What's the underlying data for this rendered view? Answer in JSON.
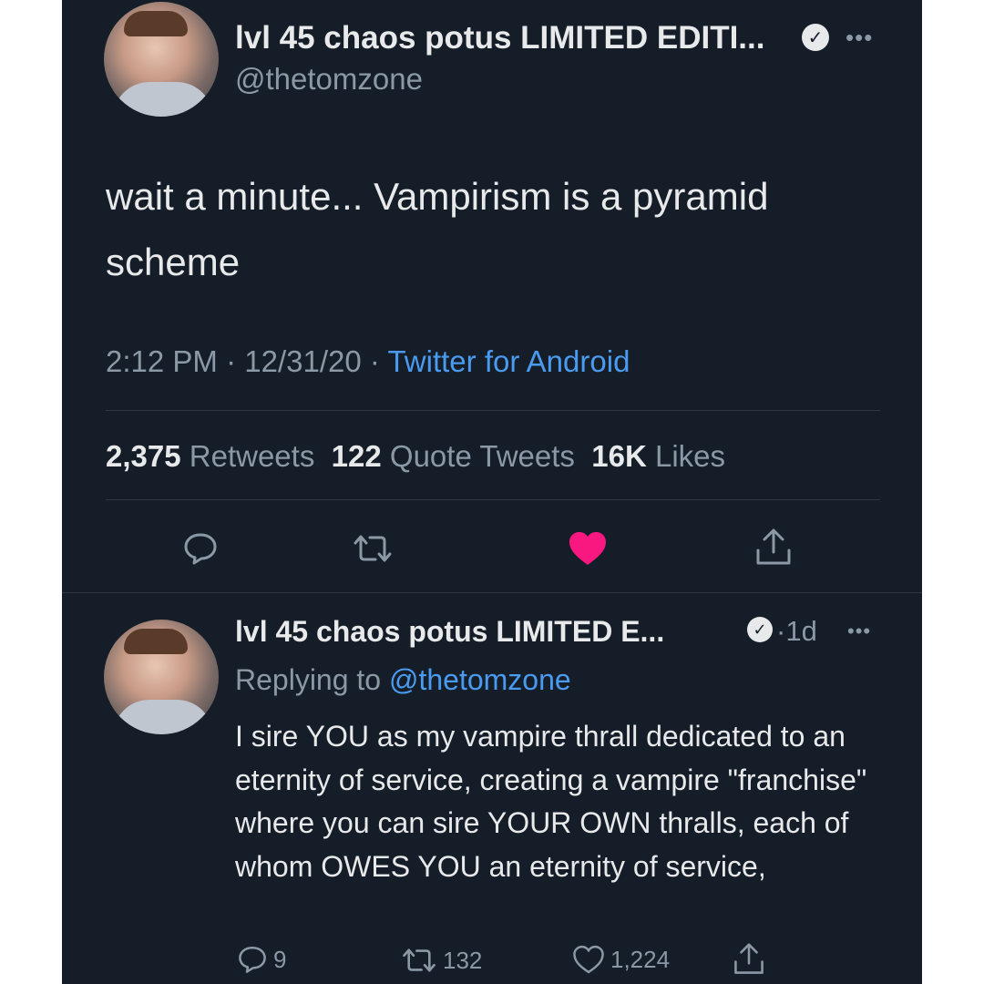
{
  "tweet": {
    "display_name": "lvl 45 chaos potus LIMITED EDITI...",
    "handle": "@thetomzone",
    "text": "wait a minute... Vampirism is a pyramid scheme",
    "time": "2:12 PM",
    "date": "12/31/20",
    "source": "Twitter for Android",
    "separator": "·",
    "stats": {
      "retweets_count": "2,375",
      "retweets_label": "Retweets",
      "quotes_count": "122",
      "quotes_label": "Quote Tweets",
      "likes_count": "16K",
      "likes_label": "Likes"
    },
    "liked": true
  },
  "reply": {
    "display_name": "lvl 45 chaos potus LIMITED E...",
    "age": "1d",
    "replying_prefix": "Replying to",
    "replying_handle": "@thetomzone",
    "text": "I sire YOU as my vampire thrall dedicated to an eternity of service, creating a vampire \"franchise\" where you can sire YOUR OWN thralls, each of whom OWES YOU an eternity of service,",
    "counts": {
      "replies": "9",
      "retweets": "132",
      "likes": "1,224"
    }
  },
  "icons": [
    "avatar",
    "verified-badge-icon",
    "more-options-icon",
    "reply-icon",
    "retweet-icon",
    "like-heart-icon",
    "share-icon"
  ],
  "colors": {
    "background": "#151d28",
    "text": "#e7e9ea",
    "muted": "#8b98a5",
    "link": "#4a9bf0",
    "like": "#f91880"
  }
}
